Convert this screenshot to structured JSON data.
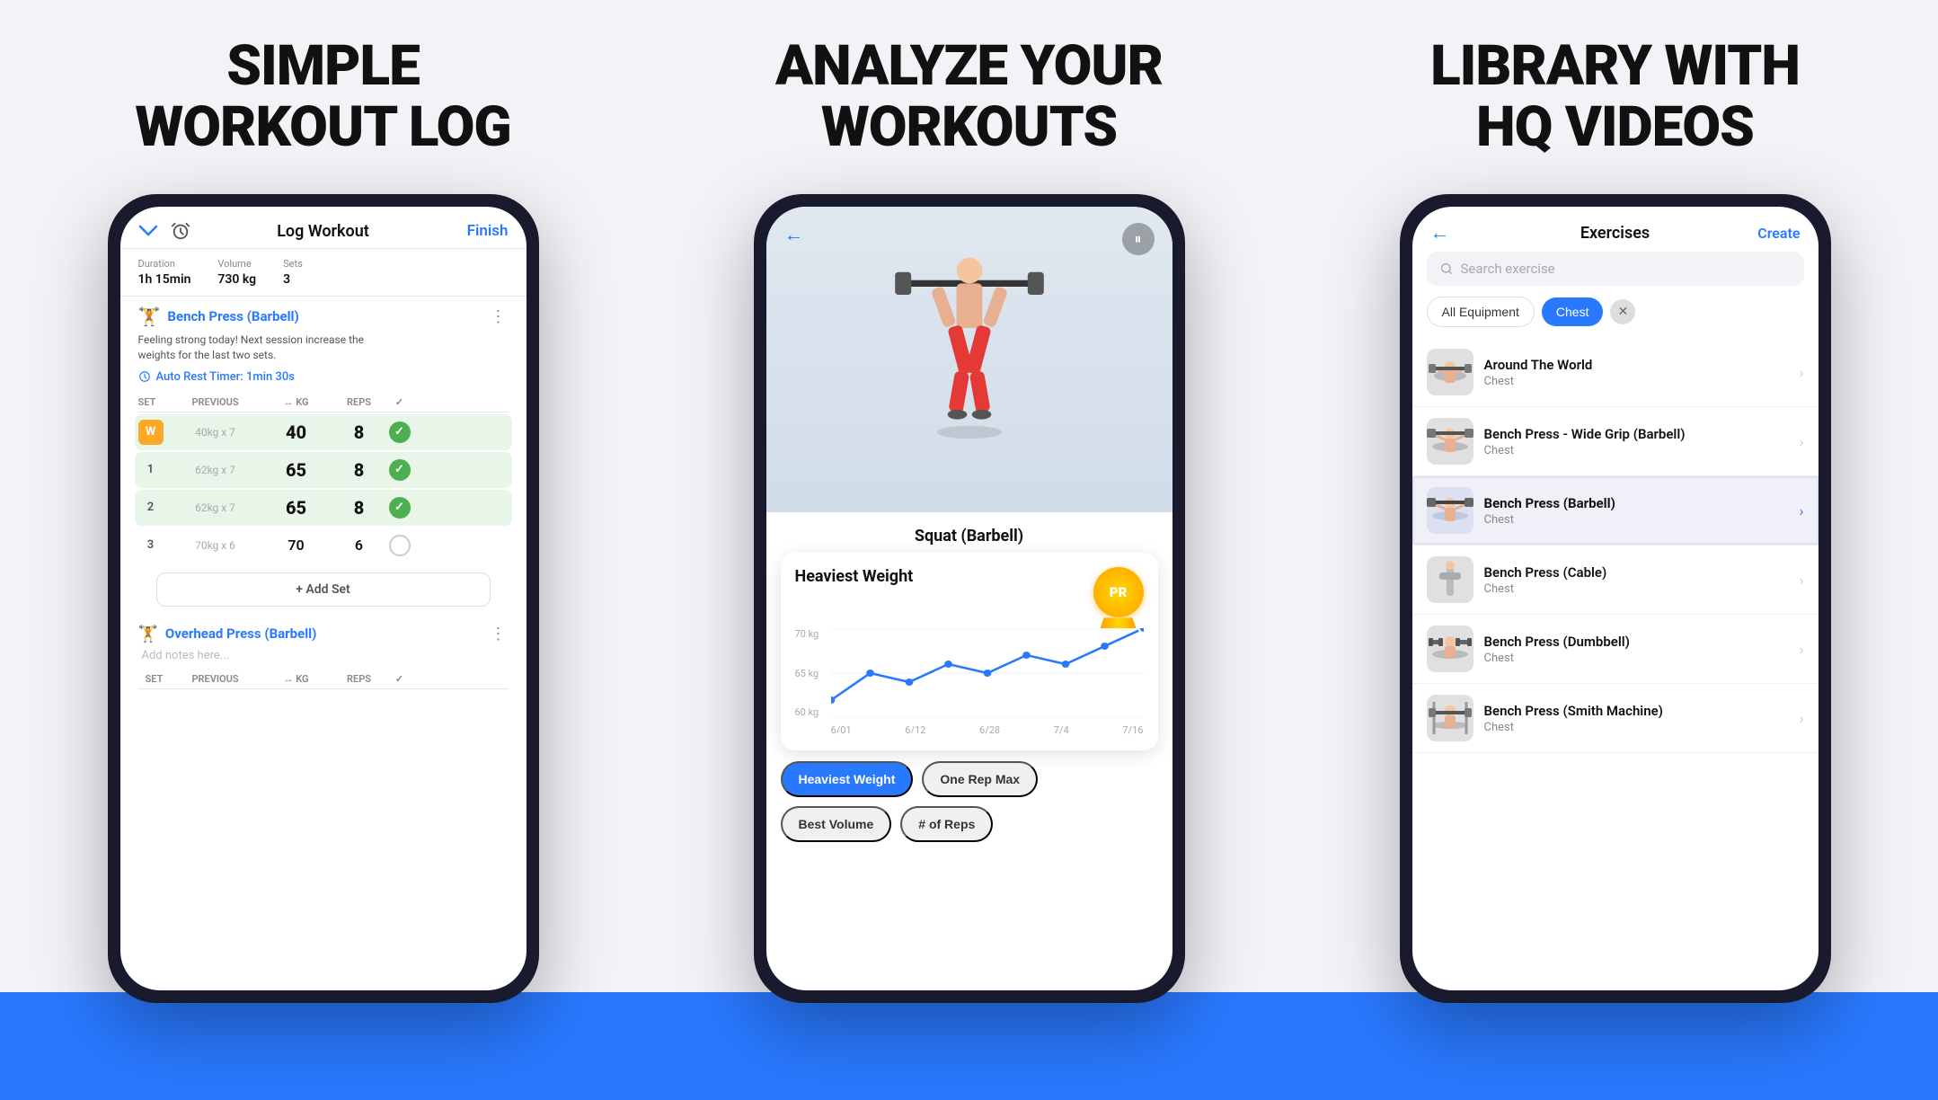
{
  "panel1": {
    "title": "SIMPLE\nWORKOUT LOG",
    "header": {
      "title": "Log Workout",
      "finish_label": "Finish"
    },
    "stats": {
      "duration_label": "Duration",
      "duration_value": "1h 15min",
      "volume_label": "Volume",
      "volume_value": "730 kg",
      "sets_label": "Sets",
      "sets_value": "3"
    },
    "exercise1": {
      "name": "Bench Press (Barbell)",
      "note": "Feeling strong today! Next session increase the\nweights for the last two sets.",
      "rest_timer": "Auto Rest Timer: 1min 30s",
      "sets": [
        {
          "label": "W",
          "prev": "40kg x 7",
          "kg": "40",
          "reps": "8",
          "done": true,
          "warm": true
        },
        {
          "label": "1",
          "prev": "62kg x 7",
          "kg": "65",
          "reps": "8",
          "done": true,
          "warm": false
        },
        {
          "label": "2",
          "prev": "62kg x 7",
          "kg": "65",
          "reps": "8",
          "done": true,
          "warm": false
        },
        {
          "label": "3",
          "prev": "70kg x 6",
          "kg": "70",
          "reps": "6",
          "done": false,
          "warm": false
        }
      ],
      "add_set": "+ Add Set",
      "col_headers": [
        "SET",
        "PREVIOUS",
        "↔ KG",
        "REPS",
        ""
      ]
    },
    "exercise2": {
      "name": "Overhead Press (Barbell)",
      "note_placeholder": "Add notes here...",
      "col_headers": [
        "SET",
        "PREVIOUS",
        "↔ KG",
        "REPS",
        ""
      ]
    }
  },
  "panel2": {
    "title": "ANALYZE YOUR\nWORKOUTS",
    "exercise_name": "Squat (Barbell)",
    "chart": {
      "title": "Heaviest Weight",
      "pr_label": "PR",
      "y_labels": [
        "70 kg",
        "65 kg",
        "60 kg"
      ],
      "x_labels": [
        "6/01",
        "6/12",
        "6/28",
        "7/4",
        "7/16"
      ],
      "data_points": [
        62,
        65,
        64,
        66,
        65,
        67,
        66,
        68,
        70
      ]
    },
    "buttons": [
      {
        "label": "Heaviest Weight",
        "active": true
      },
      {
        "label": "One Rep Max",
        "active": false
      },
      {
        "label": "Best Volume",
        "active": false
      },
      {
        "label": "# of Reps",
        "active": false
      }
    ]
  },
  "panel3": {
    "title": "LIBRARY WITH\nHQ VIDEOS",
    "header": {
      "back_label": "←",
      "title": "Exercises",
      "create_label": "Create"
    },
    "search_placeholder": "Search exercise",
    "filters": [
      {
        "label": "All Equipment",
        "active": false
      },
      {
        "label": "Chest",
        "active": true
      }
    ],
    "exercises": [
      {
        "name": "Around The World",
        "category": "Chest",
        "highlighted": false
      },
      {
        "name": "Bench Press - Wide Grip (Barbell)",
        "category": "Chest",
        "highlighted": false
      },
      {
        "name": "Bench Press (Barbell)",
        "category": "Chest",
        "highlighted": true
      },
      {
        "name": "Bench Press (Cable)",
        "category": "Chest",
        "highlighted": false
      },
      {
        "name": "Bench Press (Dumbbell)",
        "category": "Chest",
        "highlighted": false
      },
      {
        "name": "Bench Press (Smith Machine)",
        "category": "Chest",
        "highlighted": false
      }
    ]
  }
}
